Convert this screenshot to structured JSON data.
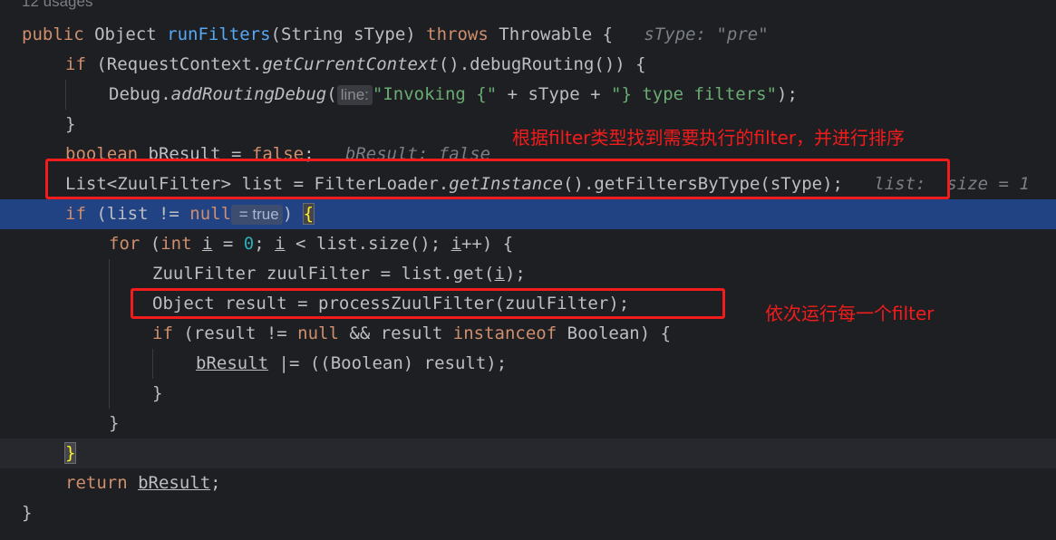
{
  "usages": "12 usages",
  "lines": [
    {
      "indent": 0,
      "tokens": [
        {
          "t": "public ",
          "c": "kw"
        },
        {
          "t": "Object ",
          "c": "type"
        },
        {
          "t": "runFilters",
          "c": "fn"
        },
        {
          "t": "(",
          "c": "type"
        },
        {
          "t": "String sType",
          "c": "type"
        },
        {
          "t": ") ",
          "c": "type"
        },
        {
          "t": "throws ",
          "c": "kw"
        },
        {
          "t": "Throwable ",
          "c": "type"
        },
        {
          "t": "{",
          "c": "type"
        },
        {
          "t": "   sType: \"pre\"",
          "c": "dbg"
        }
      ]
    },
    {
      "indent": 1,
      "tokens": [
        {
          "t": "if ",
          "c": "kw"
        },
        {
          "t": "(RequestContext.",
          "c": "type"
        },
        {
          "t": "getCurrentContext",
          "c": "it"
        },
        {
          "t": "().debugRouting()) {",
          "c": "type"
        }
      ]
    },
    {
      "indent": 2,
      "tokens": [
        {
          "t": "Debug.",
          "c": "type"
        },
        {
          "t": "addRoutingDebug",
          "c": "it"
        },
        {
          "t": "(",
          "c": "type"
        },
        {
          "t": "line:",
          "c": "hint"
        },
        {
          "t": "\"Invoking {\"",
          "c": "str"
        },
        {
          "t": " + sType + ",
          "c": "type"
        },
        {
          "t": "\"} type filters\"",
          "c": "str"
        },
        {
          "t": ");",
          "c": "type"
        }
      ]
    },
    {
      "indent": 1,
      "tokens": [
        {
          "t": "}",
          "c": "type"
        }
      ]
    },
    {
      "indent": 1,
      "tokens": [
        {
          "t": "boolean ",
          "c": "kw"
        },
        {
          "t": "bResult",
          "c": "ul"
        },
        {
          "t": " = ",
          "c": "type"
        },
        {
          "t": "false",
          "c": "kw"
        },
        {
          "t": ";",
          "c": "type"
        },
        {
          "t": "   bResult: false",
          "c": "dbg"
        }
      ]
    },
    {
      "indent": 1,
      "tokens": [
        {
          "t": "List<ZuulFilter> list = FilterLoader.",
          "c": "type"
        },
        {
          "t": "getInstance",
          "c": "it"
        },
        {
          "t": "().getFiltersByType(sType);",
          "c": "type"
        },
        {
          "t": "   list:  size = 1",
          "c": "dbg"
        }
      ]
    },
    {
      "indent": 1,
      "exec": true,
      "tokens": [
        {
          "t": "if ",
          "c": "kw"
        },
        {
          "t": "(list != ",
          "c": "type"
        },
        {
          "t": "null",
          "c": "kw"
        },
        {
          "t": " = true",
          "c": "hintval"
        },
        {
          "t": ") ",
          "c": "type"
        },
        {
          "t": "{",
          "c": "bm"
        }
      ]
    },
    {
      "indent": 2,
      "tokens": [
        {
          "t": "for ",
          "c": "kw"
        },
        {
          "t": "(",
          "c": "type"
        },
        {
          "t": "int ",
          "c": "kw"
        },
        {
          "t": "i",
          "c": "ul"
        },
        {
          "t": " = ",
          "c": "type"
        },
        {
          "t": "0",
          "c": "num"
        },
        {
          "t": "; ",
          "c": "type"
        },
        {
          "t": "i",
          "c": "ul"
        },
        {
          "t": " < list.size(); ",
          "c": "type"
        },
        {
          "t": "i",
          "c": "ul"
        },
        {
          "t": "++) {",
          "c": "type"
        }
      ]
    },
    {
      "indent": 3,
      "tokens": [
        {
          "t": "ZuulFilter zuulFilter = list.get(",
          "c": "type"
        },
        {
          "t": "i",
          "c": "ul"
        },
        {
          "t": ");",
          "c": "type"
        }
      ]
    },
    {
      "indent": 3,
      "tokens": [
        {
          "t": "Object result = processZuulFilter(zuulFilter);",
          "c": "type"
        }
      ]
    },
    {
      "indent": 3,
      "tokens": [
        {
          "t": "if ",
          "c": "kw"
        },
        {
          "t": "(result != ",
          "c": "type"
        },
        {
          "t": "null",
          "c": "kw"
        },
        {
          "t": " && result ",
          "c": "type"
        },
        {
          "t": "instanceof ",
          "c": "kw"
        },
        {
          "t": "Boolean) {",
          "c": "type"
        }
      ]
    },
    {
      "indent": 4,
      "tokens": [
        {
          "t": "bResult",
          "c": "ul"
        },
        {
          "t": " |= ((Boolean) result);",
          "c": "type"
        }
      ]
    },
    {
      "indent": 3,
      "tokens": [
        {
          "t": "}",
          "c": "type"
        }
      ]
    },
    {
      "indent": 2,
      "tokens": [
        {
          "t": "}",
          "c": "type"
        }
      ]
    },
    {
      "indent": 1,
      "caret": true,
      "tokens": [
        {
          "t": "}",
          "c": "bm"
        }
      ]
    },
    {
      "indent": 1,
      "tokens": [
        {
          "t": "return ",
          "c": "kw"
        },
        {
          "t": "bResult",
          "c": "ul"
        },
        {
          "t": ";",
          "c": "type"
        }
      ]
    },
    {
      "indent": 0,
      "tokens": [
        {
          "t": "}",
          "c": "type"
        }
      ]
    }
  ],
  "annotations": {
    "note_sort": "根据filter类型找到需要执行的filter，并进行排序",
    "note_run": "依次运行每一个filter"
  },
  "colors": {
    "annotation": "#f21c1c",
    "exec_line": "#214283",
    "keyword": "#cf8e6d",
    "function": "#56a8f5",
    "string": "#6aab73",
    "number": "#2aacb8"
  }
}
